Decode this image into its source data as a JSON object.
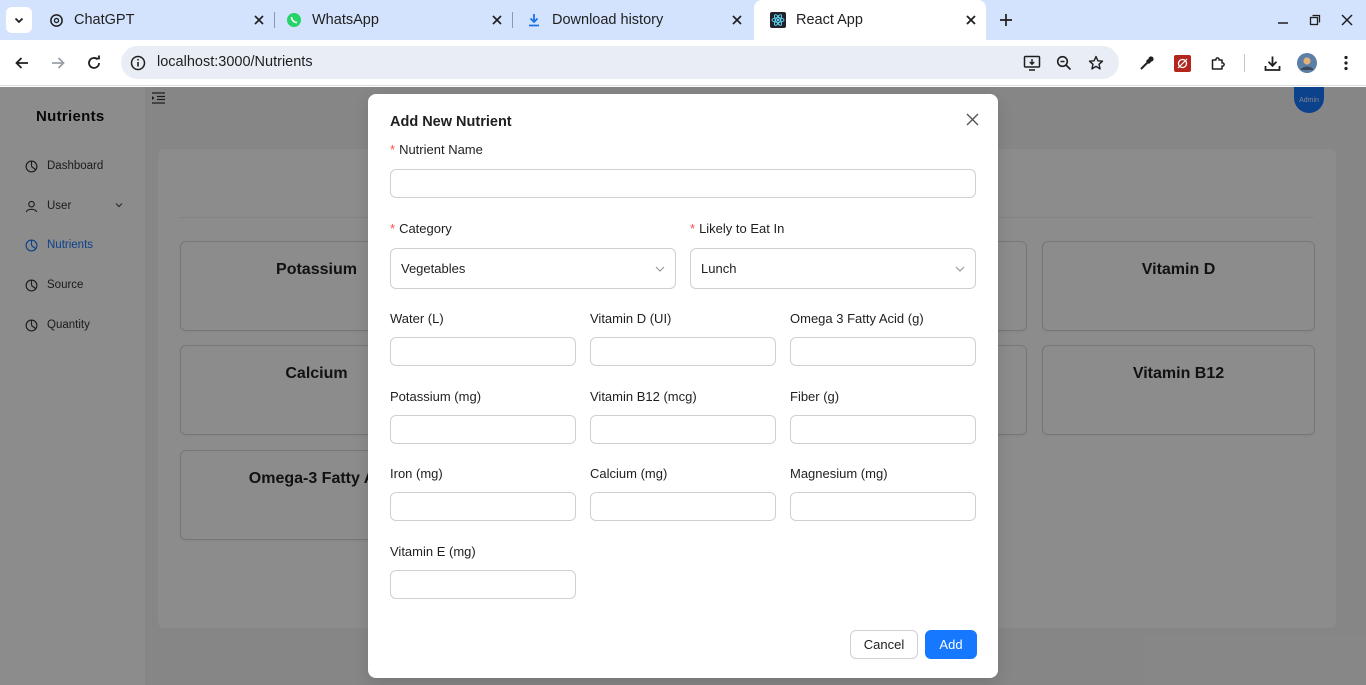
{
  "browser": {
    "tabs": [
      {
        "title": "ChatGPT",
        "icon": "chatgpt-icon"
      },
      {
        "title": "WhatsApp",
        "icon": "whatsapp-icon"
      },
      {
        "title": "Download history",
        "icon": "download-icon"
      },
      {
        "title": "React App",
        "icon": "react-icon"
      }
    ],
    "url_host": "localhost",
    "url_path": ":3000/Nutrients",
    "colors": {
      "tabstrip": "#d3e3fd",
      "omnibox": "#e9eef6"
    }
  },
  "app": {
    "brand": "Nutrients",
    "nav": [
      {
        "label": "Dashboard",
        "icon": "pie-chart-icon"
      },
      {
        "label": "User",
        "icon": "user-icon"
      },
      {
        "label": "Nutrients",
        "icon": "pie-chart-icon",
        "active": true
      },
      {
        "label": "Source",
        "icon": "pie-chart-icon"
      },
      {
        "label": "Quantity",
        "icon": "pie-chart-icon"
      }
    ],
    "avatar_text": "Admin",
    "cards": [
      "Potassium",
      "Vitamin D",
      "Calcium",
      "Vitamin B12",
      "Omega-3 Fatty Ac"
    ],
    "accent_color": "#1677ff"
  },
  "modal": {
    "title": "Add New Nutrient",
    "nutrient_name": {
      "label": "Nutrient Name",
      "value": ""
    },
    "category": {
      "label": "Category",
      "value": "Vegetables"
    },
    "likely": {
      "label": "Likely to Eat In",
      "value": "Lunch"
    },
    "fields": [
      {
        "label": "Water (L)",
        "value": ""
      },
      {
        "label": "Vitamin D (UI)",
        "value": ""
      },
      {
        "label": "Omega 3 Fatty Acid (g)",
        "value": ""
      },
      {
        "label": "Potassium (mg)",
        "value": ""
      },
      {
        "label": "Vitamin B12 (mcg)",
        "value": ""
      },
      {
        "label": "Fiber (g)",
        "value": ""
      },
      {
        "label": "Iron (mg)",
        "value": ""
      },
      {
        "label": "Calcium (mg)",
        "value": ""
      },
      {
        "label": "Magnesium (mg)",
        "value": ""
      },
      {
        "label": "Vitamin E (mg)",
        "value": ""
      }
    ],
    "cancel_label": "Cancel",
    "add_label": "Add",
    "required_color": "#ff4d4f"
  }
}
